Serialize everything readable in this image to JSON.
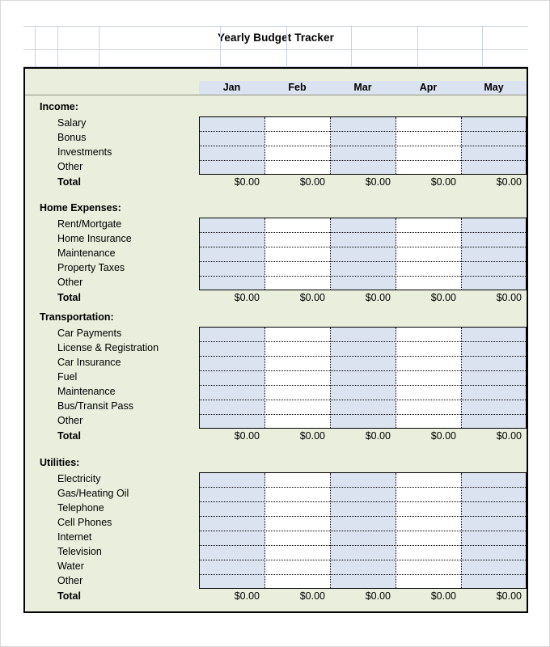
{
  "document": {
    "title": "Yearly Budget Tracker"
  },
  "columns": {
    "months": [
      "Jan",
      "Feb",
      "Mar",
      "Apr",
      "May"
    ]
  },
  "totals": {
    "label": "Total",
    "value": "$0.00"
  },
  "sections": [
    {
      "name": "income",
      "title": "Income:",
      "rows": [
        "Salary",
        "Bonus",
        "Investments",
        "Other"
      ],
      "total_label": "Total",
      "total_values": [
        "$0.00",
        "$0.00",
        "$0.00",
        "$0.00",
        "$0.00"
      ]
    },
    {
      "name": "home-expenses",
      "title": "Home Expenses:",
      "rows": [
        "Rent/Mortgate",
        "Home Insurance",
        "Maintenance",
        "Property Taxes",
        "Other"
      ],
      "total_label": "Total",
      "total_values": [
        "$0.00",
        "$0.00",
        "$0.00",
        "$0.00",
        "$0.00"
      ]
    },
    {
      "name": "transportation",
      "title": "Transportation:",
      "rows": [
        "Car Payments",
        "License & Registration",
        "Car Insurance",
        "Fuel",
        "Maintenance",
        "Bus/Transit Pass",
        "Other"
      ],
      "total_label": "Total",
      "total_values": [
        "$0.00",
        "$0.00",
        "$0.00",
        "$0.00",
        "$0.00"
      ]
    },
    {
      "name": "utilities",
      "title": "Utilities:",
      "rows": [
        "Electricity",
        "Gas/Heating Oil",
        "Telephone",
        "Cell Phones",
        "Internet",
        "Television",
        "Water",
        "Other"
      ],
      "total_label": "Total",
      "total_values": [
        "$0.00",
        "$0.00",
        "$0.00",
        "$0.00",
        "$0.00"
      ]
    }
  ],
  "colors": {
    "sheet_background": "#e9efdc",
    "cell_shade": "#dce3f0",
    "cell_empty": "#ffffff",
    "gridline": "#c9d2e4",
    "border": "#000000"
  }
}
